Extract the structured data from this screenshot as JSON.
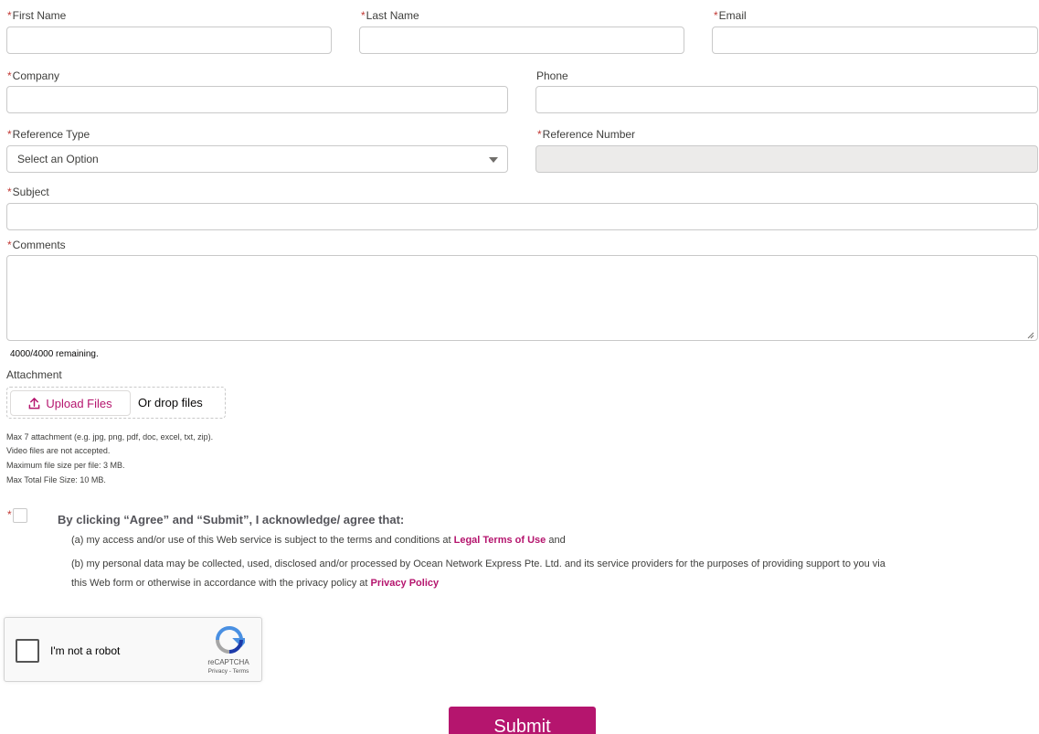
{
  "form": {
    "first_name_label": "First Name",
    "last_name_label": "Last Name",
    "email_label": "Email",
    "company_label": "Company",
    "phone_label": "Phone",
    "reference_type_label": "Reference Type",
    "reference_type_value": "Select an Option",
    "reference_number_label": "Reference Number",
    "subject_label": "Subject",
    "comments_label": "Comments",
    "comments_counter": "4000/4000 remaining.",
    "required_marker": "*"
  },
  "attachment": {
    "label": "Attachment",
    "upload_button": "Upload Files",
    "drop_text": "Or drop files",
    "help": [
      "Max 7 attachment (e.g. jpg, png, pdf, doc, excel, txt, zip).",
      "Video files are not accepted.",
      "Maximum file size per file: 3 MB.",
      "Max Total File Size: 10 MB."
    ]
  },
  "consent": {
    "heading": "By clicking “Agree” and “Submit”, I acknowledge/ agree that:",
    "line_a_prefix": "(a) my access and/or use of this Web service is subject to the terms and conditions at ",
    "line_a_link": "Legal Terms of Use",
    "line_a_suffix": " and",
    "line_b": "(b) my personal data may be collected, used, disclosed and/or processed by Ocean Network Express Pte. Ltd. and its service providers for the purposes of providing support to you via",
    "line_c_prefix": "this Web form or otherwise in accordance with the privacy policy at ",
    "line_c_link": "Privacy Policy"
  },
  "captcha": {
    "label": "I'm not a robot",
    "brand": "reCAPTCHA",
    "links": "Privacy - Terms"
  },
  "submit_label": "Submit",
  "colors": {
    "accent": "#b5156e",
    "required": "#c23934",
    "disabled_bg": "#ecebea"
  },
  "icons": {
    "upload": "upload-icon",
    "dropdown": "chevron-down-icon",
    "recaptcha": "recaptcha-logo-icon"
  }
}
